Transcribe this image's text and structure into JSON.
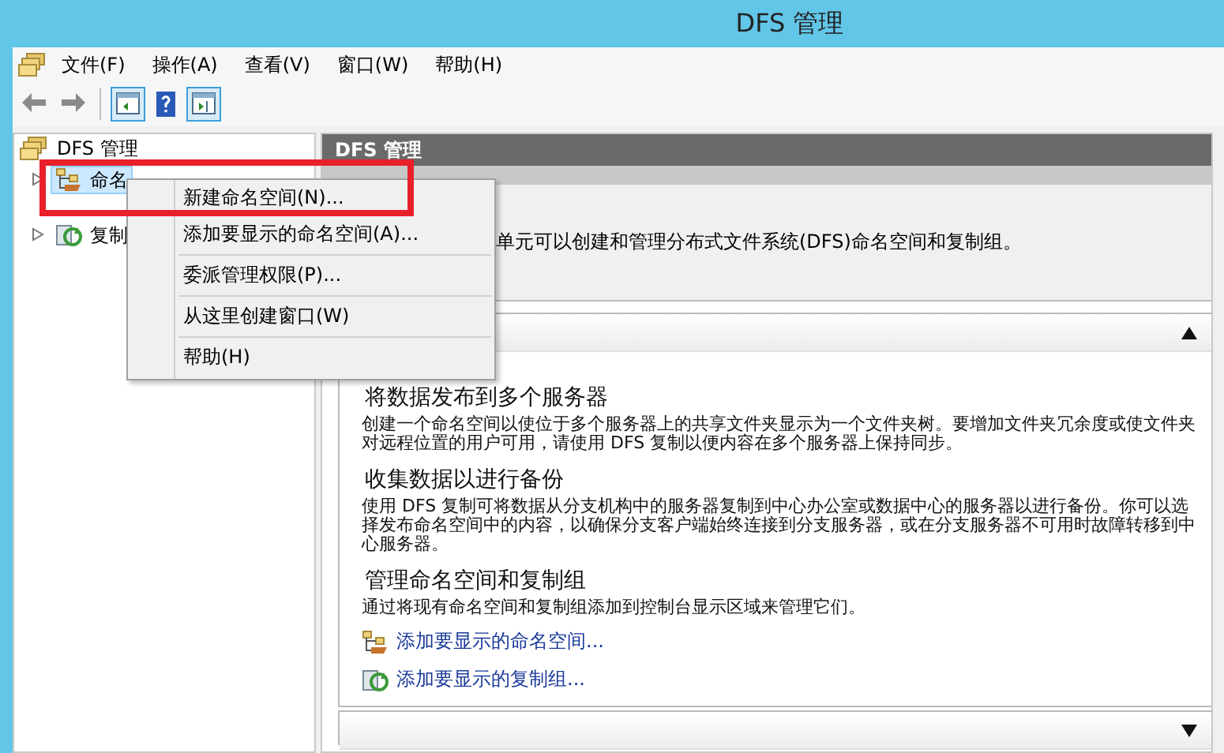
{
  "window": {
    "title": "DFS 管理"
  },
  "menu_bar": [
    "文件(F)",
    "操作(A)",
    "查看(V)",
    "窗口(W)",
    "帮助(H)"
  ],
  "toolbar": [
    {
      "kind": "back",
      "pressed": false
    },
    {
      "kind": "forward",
      "pressed": false
    },
    {
      "kind": "tree",
      "pressed": true
    },
    {
      "kind": "help",
      "pressed": false
    },
    {
      "kind": "actions",
      "pressed": true
    }
  ],
  "tree": {
    "label": "DFS 管理",
    "children": [
      {
        "label": "命名",
        "kind": "namespace",
        "selected": true,
        "expanded": false
      },
      {
        "label": "复制",
        "kind": "replication",
        "selected": false,
        "expanded": false
      }
    ]
  },
  "main": {
    "header": "DFS 管理",
    "description": "单元可以创建和管理分布式文件系统(DFS)命名空间和复制组。",
    "panels": [
      {
        "expanded": true,
        "sections": [
          {
            "heading": "将数据发布到多个服务器",
            "text": "创建一个命名空间以使位于多个服务器上的共享文件夹显示为一个文件夹树。要增加文件夹冗余度或使文件夹对远程位置的用户可用，请使用 DFS 复制以便内容在多个服务器上保持同步。"
          },
          {
            "heading": "收集数据以进行备份",
            "text": "使用 DFS 复制可将数据从分支机构中的服务器复制到中心办公室或数据中心的服务器以进行备份。你可以选择发布命名空间中的内容，以确保分支客户端始终连接到分支服务器，或在分支服务器不可用时故障转移到中心服务器。"
          },
          {
            "heading": "管理命名空间和复制组",
            "text": "通过将现有命名空间和复制组添加到控制台显示区域来管理它们。",
            "links": [
              {
                "kind": "namespace",
                "label": "添加要显示的命名空间..."
              },
              {
                "kind": "replication",
                "label": "添加要显示的复制组..."
              }
            ]
          }
        ]
      },
      {
        "expanded": false
      }
    ]
  },
  "context_menu": {
    "groups": [
      [
        "新建命名空间(N)...",
        "添加要显示的命名空间(A)..."
      ],
      [
        "委派管理权限(P)..."
      ],
      [
        "从这里创建窗口(W)"
      ],
      [
        "帮助(H)"
      ]
    ]
  }
}
